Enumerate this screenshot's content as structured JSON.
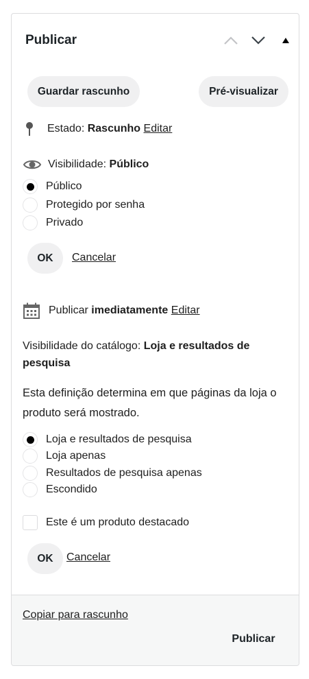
{
  "header": {
    "title": "Publicar"
  },
  "actions": {
    "save_draft": "Guardar rascunho",
    "preview": "Pré-visualizar"
  },
  "status": {
    "label": "Estado:",
    "value": "Rascunho",
    "edit": "Editar"
  },
  "visibility": {
    "label": "Visibilidade:",
    "value": "Público",
    "options": [
      "Público",
      "Protegido por senha",
      "Privado"
    ],
    "selected": "Público",
    "ok": "OK",
    "cancel": "Cancelar"
  },
  "schedule": {
    "label": "Publicar",
    "value": "imediatamente",
    "edit": "Editar"
  },
  "catalog": {
    "label": "Visibilidade do catálogo:",
    "value": "Loja e resultados de pesquisa",
    "description": "Esta definição determina em que páginas da loja o produto será mostrado.",
    "options": [
      "Loja e resultados de pesquisa",
      "Loja apenas",
      "Resultados de pesquisa apenas",
      "Escondido"
    ],
    "selected": "Loja e resultados de pesquisa",
    "featured_label": "Este é um produto destacado",
    "featured_checked": false,
    "ok": "OK",
    "cancel": "Cancelar"
  },
  "footer": {
    "copy_draft": "Copiar para rascunho",
    "publish": "Publicar"
  },
  "icons": {
    "status": "pin-icon",
    "visibility": "eye-icon",
    "schedule": "calendar-icon"
  },
  "colors": {
    "button_bg": "#f0f0f1",
    "footer_bg": "#f6f7f7",
    "border": "#dcdcde"
  }
}
